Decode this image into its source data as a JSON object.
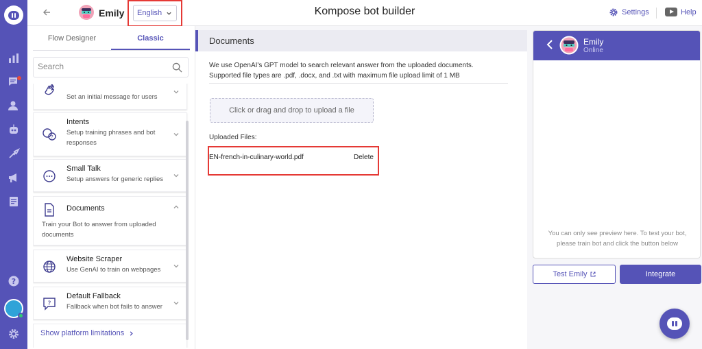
{
  "app": {
    "title": "Kompose bot builder"
  },
  "header": {
    "bot_name": "Emily",
    "language": "English",
    "settings_label": "Settings",
    "help_label": "Help"
  },
  "sidebar": {
    "icons": [
      "logo-icon",
      "analytics-icon",
      "conversations-icon",
      "users-icon",
      "bot-icon",
      "integrations-icon",
      "campaigns-icon",
      "reports-icon",
      "help-icon",
      "settings-icon"
    ]
  },
  "panel": {
    "tabs": [
      {
        "label": "Flow Designer"
      },
      {
        "label": "Classic"
      }
    ],
    "active_tab": "Classic",
    "search_placeholder": "Search",
    "items": [
      {
        "title": "",
        "desc": "Set an initial message for users",
        "icon": "wave-hand-icon"
      },
      {
        "title": "Intents",
        "desc": "Setup training phrases and bot responses",
        "icon": "intents-icon"
      },
      {
        "title": "Small Talk",
        "desc": "Setup answers for generic replies",
        "icon": "chat-bubble-icon"
      },
      {
        "title": "Documents",
        "desc": "Train your Bot to answer from uploaded documents",
        "icon": "document-icon"
      },
      {
        "title": "Website Scraper",
        "desc": "Use GenAI to train on webpages",
        "icon": "globe-icon"
      },
      {
        "title": "Default Fallback",
        "desc": "Fallback when bot fails to answer",
        "icon": "fallback-icon"
      }
    ],
    "limits_link": "Show platform limitations"
  },
  "documents": {
    "heading": "Documents",
    "info_line1": "We use OpenAI's GPT model to search relevant answer from the uploaded documents.",
    "info_line2": "Supported file types are .pdf, .docx, and .txt with maximum file upload limit of 1 MB",
    "upload_label": "Click or drag and drop to upload a file",
    "uploaded_label": "Uploaded Files:",
    "files": [
      {
        "name": "EN-french-in-culinary-world.pdf",
        "action": "Delete"
      }
    ]
  },
  "chat": {
    "name": "Emily",
    "status": "Online",
    "note_line1": "You can only see preview here. To test your bot,",
    "note_line2": "please train bot and click the button below",
    "test_label": "Test Emily",
    "integrate_label": "Integrate"
  },
  "colors": {
    "brand": "#5553b7",
    "highlight": "#e53935",
    "online": "#2ecc71",
    "notification": "#e74c3c"
  }
}
